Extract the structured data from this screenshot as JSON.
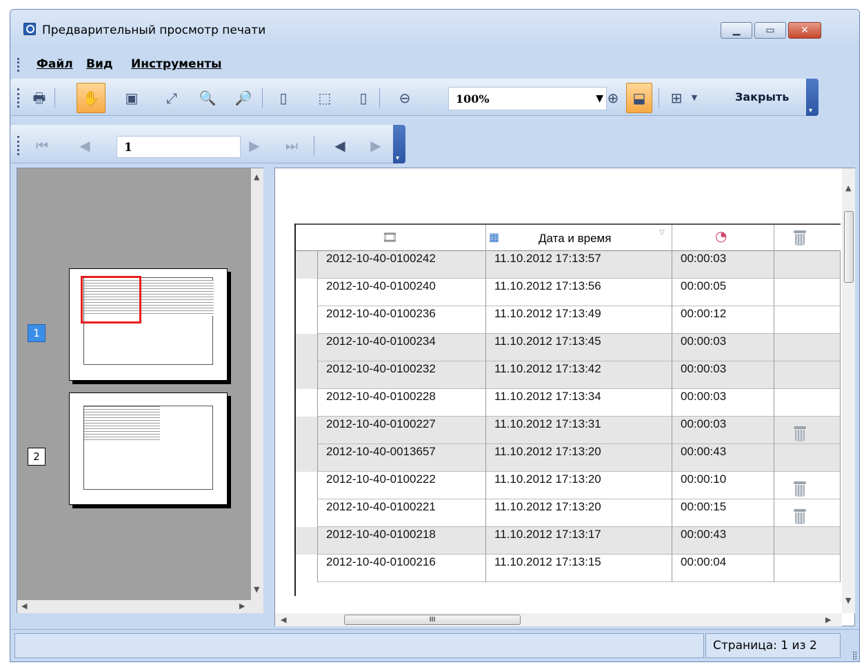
{
  "window": {
    "title": "Предварительный просмотр печати"
  },
  "menu": {
    "items": [
      "Файл",
      "Вид",
      "Инструменты"
    ]
  },
  "toolbar": {
    "zoom_value": "100%",
    "close_label": "Закрыть",
    "icons": [
      "print-icon",
      "hand-icon",
      "snapshot-icon",
      "zoom-fit-icon",
      "zoom-out-icon",
      "zoom-in-icon",
      "single-page-icon",
      "page-margins-icon",
      "page-setup-icon",
      "zoom-minus-icon",
      "zoom-plus-icon",
      "fit-width-icon",
      "multi-page-icon"
    ]
  },
  "navigation": {
    "page_input": "1"
  },
  "thumbnails": [
    {
      "number": "1",
      "selected": true
    },
    {
      "number": "2",
      "selected": false
    }
  ],
  "table": {
    "header": {
      "date_label": "Дата и время"
    },
    "rows": [
      {
        "id": "2012-10-40-0100242",
        "datetime": "11.10.2012 17:13:57",
        "duration": "00:00:03",
        "deleted": false,
        "shaded": true
      },
      {
        "id": "2012-10-40-0100240",
        "datetime": "11.10.2012 17:13:56",
        "duration": "00:00:05",
        "deleted": false,
        "shaded": false
      },
      {
        "id": "2012-10-40-0100236",
        "datetime": "11.10.2012 17:13:49",
        "duration": "00:00:12",
        "deleted": false,
        "shaded": false
      },
      {
        "id": "2012-10-40-0100234",
        "datetime": "11.10.2012 17:13:45",
        "duration": "00:00:03",
        "deleted": false,
        "shaded": true
      },
      {
        "id": "2012-10-40-0100232",
        "datetime": "11.10.2012 17:13:42",
        "duration": "00:00:03",
        "deleted": false,
        "shaded": true
      },
      {
        "id": "2012-10-40-0100228",
        "datetime": "11.10.2012 17:13:34",
        "duration": "00:00:03",
        "deleted": false,
        "shaded": false
      },
      {
        "id": "2012-10-40-0100227",
        "datetime": "11.10.2012 17:13:31",
        "duration": "00:00:03",
        "deleted": true,
        "shaded": true
      },
      {
        "id": "2012-10-40-0013657",
        "datetime": "11.10.2012 17:13:20",
        "duration": "00:00:43",
        "deleted": false,
        "shaded": true
      },
      {
        "id": "2012-10-40-0100222",
        "datetime": "11.10.2012 17:13:20",
        "duration": "00:00:10",
        "deleted": true,
        "shaded": false
      },
      {
        "id": "2012-10-40-0100221",
        "datetime": "11.10.2012 17:13:20",
        "duration": "00:00:15",
        "deleted": true,
        "shaded": false
      },
      {
        "id": "2012-10-40-0100218",
        "datetime": "11.10.2012 17:13:17",
        "duration": "00:00:43",
        "deleted": false,
        "shaded": true
      },
      {
        "id": "2012-10-40-0100216",
        "datetime": "11.10.2012 17:13:15",
        "duration": "00:00:04",
        "deleted": false,
        "shaded": false
      }
    ]
  },
  "scrollbar": {
    "h_thumb_label": "III"
  },
  "status": {
    "page_text": "Страница: 1 из 2"
  }
}
